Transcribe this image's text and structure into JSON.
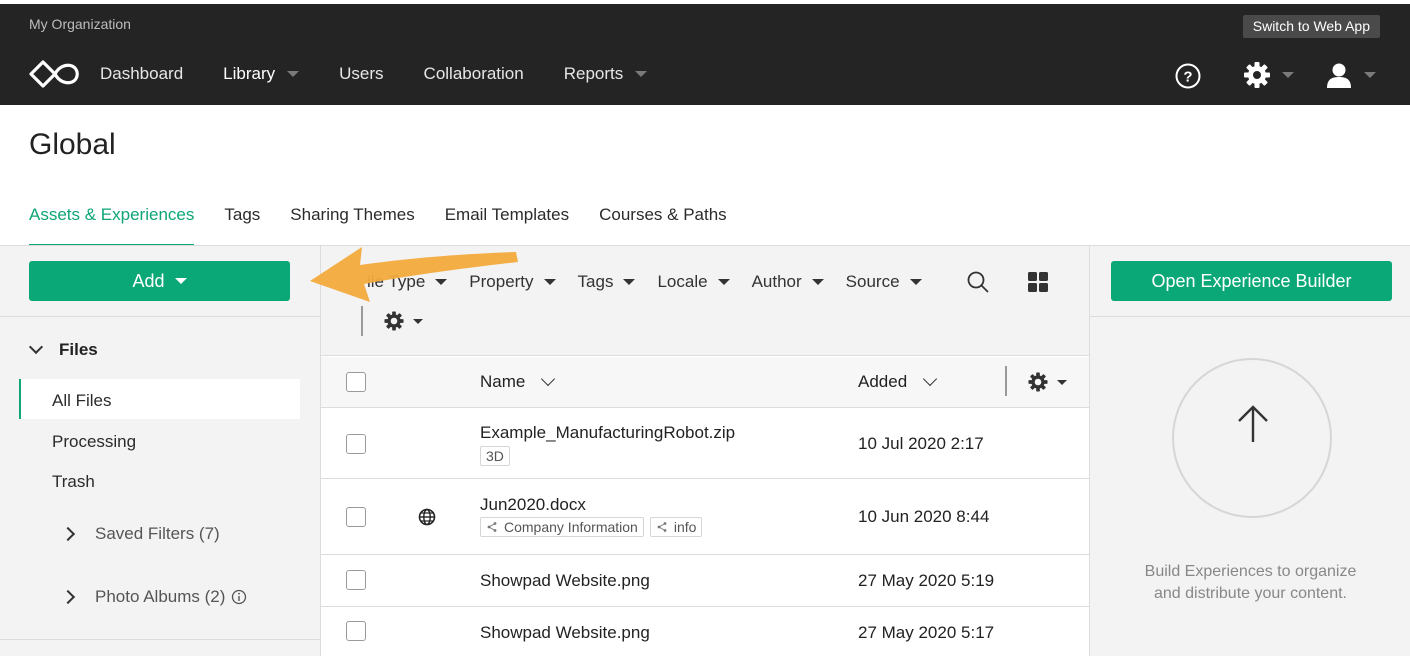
{
  "topbar": {
    "org_name": "My Organization",
    "switch_label": "Switch to Web App",
    "nav": [
      {
        "label": "Dashboard"
      },
      {
        "label": "Library"
      },
      {
        "label": "Users"
      },
      {
        "label": "Collaboration"
      },
      {
        "label": "Reports"
      }
    ],
    "icons": [
      "help-icon",
      "gear-icon",
      "user-icon"
    ]
  },
  "page": {
    "title": "Global",
    "tabs": [
      "Assets & Experiences",
      "Tags",
      "Sharing Themes",
      "Email Templates",
      "Courses & Paths"
    ],
    "active_tab": "Assets & Experiences"
  },
  "sidebar": {
    "add_label": "Add",
    "files_label": "Files",
    "items": [
      "All Files",
      "Processing",
      "Trash"
    ],
    "saved_filters": "Saved Filters (7)",
    "photo_albums": "Photo Albums (2)"
  },
  "filters": {
    "items": [
      "ile Type",
      "Property",
      "Tags",
      "Locale",
      "Author",
      "Source"
    ]
  },
  "table": {
    "col_name": "Name",
    "col_added": "Added",
    "rows": [
      {
        "name": "Example_ManufacturingRobot.zip",
        "tags": [
          "3D"
        ],
        "added": "10 Jul 2020 2:17"
      },
      {
        "name": "Jun2020.docx",
        "tags": [
          "Company Information",
          "info"
        ],
        "added": "10 Jun 2020 8:44"
      },
      {
        "name": "Showpad Website.png",
        "tags": [],
        "added": "27 May 2020 5:19"
      },
      {
        "name": "Showpad Website.png",
        "tags": [],
        "added": "27 May 2020 5:17"
      }
    ]
  },
  "right": {
    "open_builder_label": "Open Experience Builder",
    "empty_text": "Build Experiences to organize and distribute your content."
  },
  "colors": {
    "accent": "#0ba877",
    "topbar": "#242424",
    "annotation_arrow": "#f2aa3c"
  }
}
